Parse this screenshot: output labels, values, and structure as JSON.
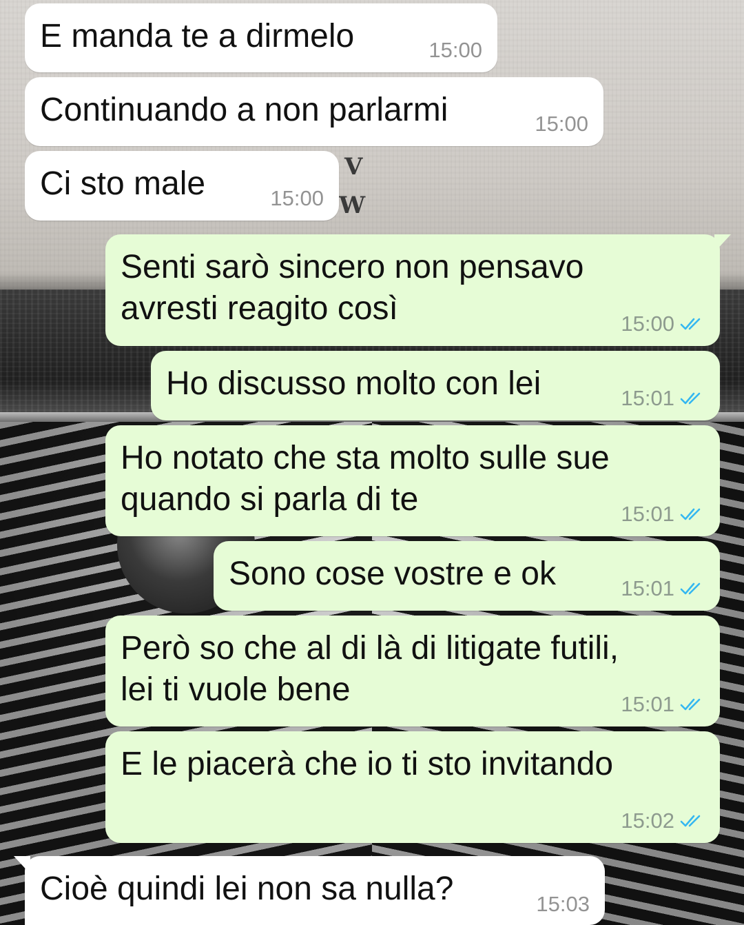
{
  "messages": [
    {
      "direction": "incoming",
      "text": "E manda te a dirmelo",
      "time": "15:00",
      "ticks": false
    },
    {
      "direction": "incoming",
      "text": "Continuando a non parlarmi",
      "time": "15:00",
      "ticks": false
    },
    {
      "direction": "incoming",
      "text": "Ci sto male",
      "time": "15:00",
      "ticks": false
    },
    {
      "direction": "outgoing",
      "text": "Senti sarò sincero non pensavo\navresti reagito così",
      "time": "15:00",
      "ticks": true
    },
    {
      "direction": "outgoing",
      "text": "Ho discusso molto con lei",
      "time": "15:01",
      "ticks": true
    },
    {
      "direction": "outgoing",
      "text": "Ho notato che sta molto sulle sue\nquando si parla di te",
      "time": "15:01",
      "ticks": true
    },
    {
      "direction": "outgoing",
      "text": "Sono cose vostre e ok",
      "time": "15:01",
      "ticks": true
    },
    {
      "direction": "outgoing",
      "text": "Però so che al di là di litigate futili,\nlei ti vuole bene",
      "time": "15:01",
      "ticks": true
    },
    {
      "direction": "outgoing",
      "text": "E le piacerà che io ti sto invitando",
      "time": "15:02",
      "ticks": true
    },
    {
      "direction": "incoming",
      "text": "Cioè quindi lei non sa nulla?",
      "time": "15:03",
      "ticks": false
    }
  ],
  "colors": {
    "incoming_bubble": "#ffffff",
    "outgoing_bubble": "#e6fcd6",
    "read_ticks": "#34b7f1"
  },
  "icons": {
    "read_receipt": "double-check-icon"
  }
}
